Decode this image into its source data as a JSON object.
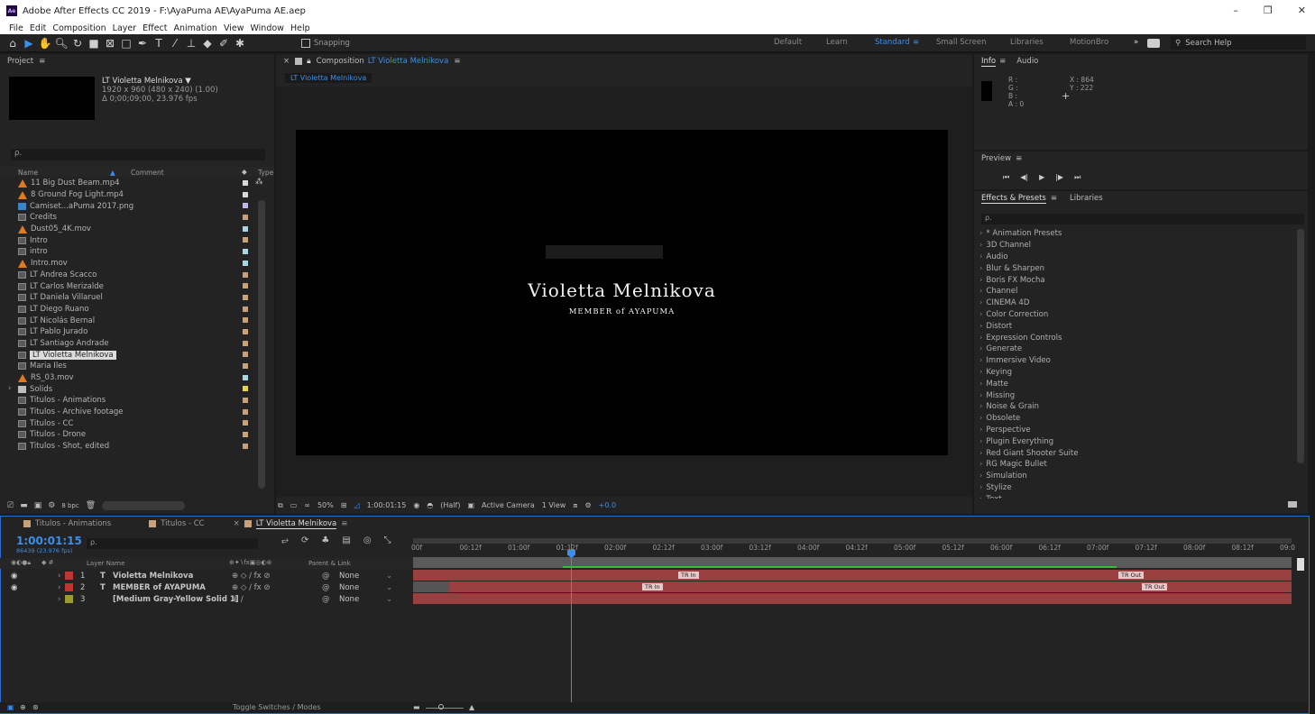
{
  "window": {
    "title": "Adobe After Effects CC 2019 - F:\\AyaPuma AE\\AyaPuma AE.aep",
    "app_badge": "Ae",
    "minimize": "–",
    "restore": "❐",
    "close": "✕"
  },
  "menu": [
    "File",
    "Edit",
    "Composition",
    "Layer",
    "Effect",
    "Animation",
    "View",
    "Window",
    "Help"
  ],
  "toolbar": {
    "snapping_label": "Snapping",
    "workspaces": [
      "Default",
      "Learn",
      "Standard",
      "Small Screen",
      "Libraries",
      "MotionBro"
    ],
    "active_workspace": "Standard",
    "more": "»",
    "search_help": "Search Help"
  },
  "project": {
    "tab": "Project",
    "comp_name": "LT Violetta Melnikova ▼",
    "comp_size": "1920 x 960  (480 x 240) (1.00)",
    "comp_duration": "Δ 0;00;09;00, 23.976 fps",
    "search_placeholder": "ρ.",
    "col_name": "Name",
    "col_comment": "Comment",
    "col_type": "Type",
    "items": [
      {
        "name": "11 Big Dust Beam.mp4",
        "kind": "cone",
        "color": "#d8d8d8"
      },
      {
        "name": "8 Ground Fog Light.mp4",
        "kind": "cone",
        "color": "#d8d8d8"
      },
      {
        "name": "Camiset...aPuma 2017.png",
        "kind": "img",
        "color": "#bfb8e6"
      },
      {
        "name": "Credits",
        "kind": "comp",
        "color": "#c8a07a"
      },
      {
        "name": "Dust05_4K.mov",
        "kind": "cone",
        "color": "#a9d6e0"
      },
      {
        "name": "Intro",
        "kind": "comp",
        "color": "#c8a07a"
      },
      {
        "name": "intro",
        "kind": "comp",
        "color": "#a9d6e0"
      },
      {
        "name": "Intro.mov",
        "kind": "cone",
        "color": "#a9d6e0"
      },
      {
        "name": "LT Andrea Scacco",
        "kind": "comp",
        "color": "#c8a07a"
      },
      {
        "name": "LT Carlos Merizalde",
        "kind": "comp",
        "color": "#c8a07a"
      },
      {
        "name": "LT Daniela Villaruel",
        "kind": "comp",
        "color": "#c8a07a"
      },
      {
        "name": "LT Diego Ruano",
        "kind": "comp",
        "color": "#c8a07a"
      },
      {
        "name": "LT Nicolás Bernal",
        "kind": "comp",
        "color": "#c8a07a"
      },
      {
        "name": "LT Pablo Jurado",
        "kind": "comp",
        "color": "#c8a07a"
      },
      {
        "name": "LT Santiago Andrade",
        "kind": "comp",
        "color": "#c8a07a"
      },
      {
        "name": "LT Violetta Melnikova",
        "kind": "comp",
        "color": "#c8a07a",
        "selected": true
      },
      {
        "name": "Maria Iles",
        "kind": "comp",
        "color": "#c8a07a"
      },
      {
        "name": "RS_03.mov",
        "kind": "cone",
        "color": "#a9d6e0"
      },
      {
        "name": "Solids",
        "kind": "folder",
        "color": "#e6d34a",
        "folder": true
      },
      {
        "name": "Titulos - Animations",
        "kind": "comp",
        "color": "#c8a07a"
      },
      {
        "name": "Titulos - Archive footage",
        "kind": "comp",
        "color": "#c8a07a"
      },
      {
        "name": "Titulos - CC",
        "kind": "comp",
        "color": "#c8a07a"
      },
      {
        "name": "Titulos - Drone",
        "kind": "comp",
        "color": "#c8a07a"
      },
      {
        "name": "Titulos - Shot, edited",
        "kind": "comp",
        "color": "#c8a07a"
      }
    ],
    "bpc": "8 bpc"
  },
  "composition": {
    "panel_title": "Composition",
    "comp_link": "LT Violetta Melnikova",
    "tab": "LT Violetta Melnikova",
    "title_text": "Violetta Melnikova",
    "subtitle_text": "MEMBER of AYAPUMA",
    "footer": {
      "zoom": "50%",
      "timecode": "1:00:01:15",
      "resolution": "(Half)",
      "camera": "Active Camera",
      "view": "1 View",
      "exposure": "+0.0"
    }
  },
  "info": {
    "tab_info": "Info",
    "tab_audio": "Audio",
    "r": "R :",
    "g": "G :",
    "b": "B :",
    "a": "A : 0",
    "x": "X : 864",
    "y": "Y : 222"
  },
  "preview": {
    "title": "Preview"
  },
  "effects": {
    "tab": "Effects & Presets",
    "tab2": "Libraries",
    "search": "ρ.",
    "items": [
      "* Animation Presets",
      "3D Channel",
      "Audio",
      "Blur & Sharpen",
      "Boris FX Mocha",
      "Channel",
      "CINEMA 4D",
      "Color Correction",
      "Distort",
      "Expression Controls",
      "Generate",
      "Immersive Video",
      "Keying",
      "Matte",
      "Missing",
      "Noise & Grain",
      "Obsolete",
      "Perspective",
      "Plugin Everything",
      "Red Giant Shooter Suite",
      "RG Magic Bullet",
      "Simulation",
      "Stylize",
      "Text"
    ]
  },
  "timeline": {
    "tabs": [
      "Titulos - Animations",
      "Titulos - CC",
      "LT Violetta Melnikova"
    ],
    "current_time": "1:00:01:15",
    "frames": "86439 (23.976 fps)",
    "search": "ρ.",
    "col_layer_name": "Layer Name",
    "col_parent": "Parent & Link",
    "ruler": [
      "00f",
      "00:12f",
      "01:00f",
      "01:12f",
      "02:00f",
      "02:12f",
      "03:00f",
      "03:12f",
      "04:00f",
      "04:12f",
      "05:00f",
      "05:12f",
      "06:00f",
      "06:12f",
      "07:00f",
      "07:12f",
      "08:00f",
      "08:12f",
      "09:0"
    ],
    "layers": [
      {
        "num": "1",
        "type": "T",
        "name": "Violetta Melnikova",
        "parent": "None",
        "color": "#c23434",
        "in_label": "TR In",
        "out_label": "TR Out"
      },
      {
        "num": "2",
        "type": "T",
        "name": "MEMBER of AYAPUMA",
        "parent": "None",
        "color": "#c23434",
        "in_label": "TR In",
        "out_label": "TR Out"
      },
      {
        "num": "3",
        "type": "",
        "name": "[Medium Gray-Yellow Solid 1]",
        "parent": "None",
        "color": "#9b9b2e"
      }
    ],
    "toggle_label": "Toggle Switches / Modes"
  }
}
